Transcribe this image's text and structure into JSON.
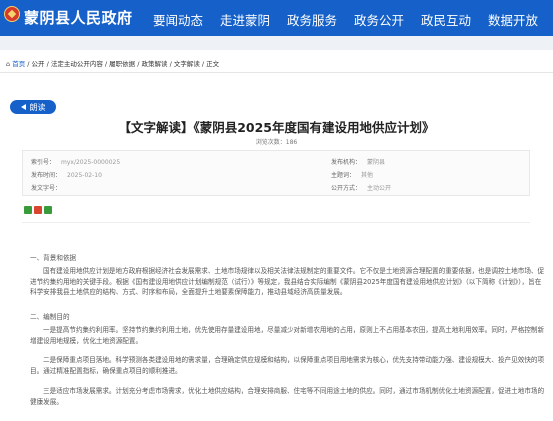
{
  "header": {
    "site_title": "蒙阴县人民政府",
    "nav": [
      "要闻动态",
      "走进蒙阴",
      "政务服务",
      "政务公开",
      "政民互动",
      "数据开放"
    ]
  },
  "breadcrumb": {
    "home": "首页",
    "path": " / 公开 / 法定主动公开内容 / 履职依据 / 政策解读 / 文字解读 / 正文"
  },
  "read_button": "朗读",
  "article": {
    "title": "【文字解读】《蒙阴县2025年度国有建设用地供应计划》",
    "views": "浏览次数：186",
    "meta": {
      "index_label": "索引号：",
      "index_value": "myx/2025-0000025",
      "org_label": "发布机构：",
      "org_value": "蒙阴县",
      "date_label": "发布时间：",
      "date_value": "2025-02-10",
      "topic_label": "主题词：",
      "topic_value": "其他",
      "doc_label": "发文字号：",
      "doc_value": "",
      "mode_label": "公开方式：",
      "mode_value": "主动公开"
    },
    "body": {
      "s1_title": "一、背景和依据",
      "p1": "国有建设用地供应计划是地方政府根据经济社会发展需求、土地市场规律以及相关法律法规制定的重要文件。它不仅是土地资源合理配置的重要依据，也是调控土地市场、促进节约集约用地的关键手段。根据《国有建设用地供应计划编制规范（试行）》等规定，我县结合实际编制《蒙阴县2025年度国有建设用地供应计划》（以下简称《计划》），旨在科学安排我县土地供应的结构、方式、时序和布局，全面提升土地要素保障能力，推动县域经济高质量发展。",
      "s2_title": "二、编制目的",
      "p2": "一是提高节约集约利用率。坚持节约集约利用土地，优先使用存量建设用地，尽量减少对新增农用地的占用，原则上不占用基本农田，提高土地利用效率。同时，严格控制新增建设用地规模，优化土地资源配置。",
      "p3": "二是保障重点项目落地。科学预测各类建设用地的需求量，合理确定供应规模和结构，以保障重点项目用地需求为核心，优先支持带动能力强、建设规模大、投产见效快的项目。通过精准配置指标，确保重点项目的顺利推进。",
      "p4": "三是适应市场发展需求。计划充分考虑市场需求，优化土地供应结构，合理安排商服、住宅等不同用途土地的供应。同时，通过市场机制优化土地资源配置，促进土地市场的健康发展。"
    }
  },
  "colors": {
    "brand": "#1561c9",
    "logo_red": "#d73a2b"
  }
}
